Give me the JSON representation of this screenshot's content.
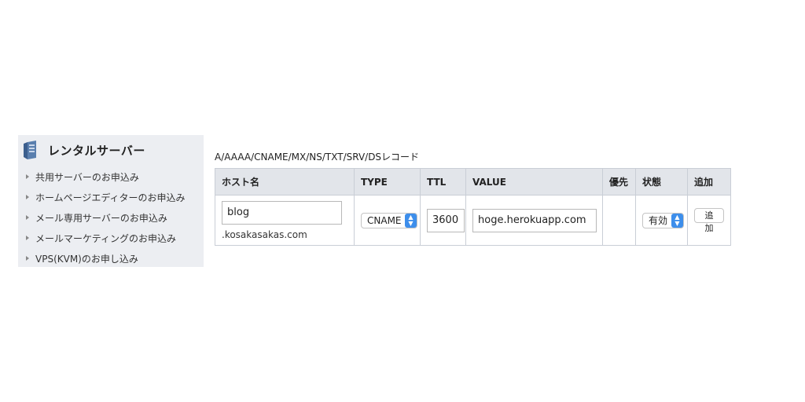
{
  "sidebar": {
    "title": "レンタルサーバー",
    "items": [
      {
        "label": "共用サーバーのお申込み"
      },
      {
        "label": "ホームページエディターのお申込み"
      },
      {
        "label": "メール専用サーバーのお申込み"
      },
      {
        "label": "メールマーケティングのお申込み"
      },
      {
        "label": "VPS(KVM)のお申し込み"
      }
    ]
  },
  "records": {
    "caption": "A/AAAA/CNAME/MX/NS/TXT/SRV/DSレコード",
    "headers": {
      "host": "ホスト名",
      "type": "TYPE",
      "ttl": "TTL",
      "value": "VALUE",
      "priority": "優先",
      "state": "状態",
      "add": "追加"
    },
    "row": {
      "host": "blog",
      "domain_suffix": ".kosakasakas.com",
      "type": "CNAME",
      "ttl": "3600",
      "value": "hoge.herokuapp.com",
      "priority": "",
      "state": "有効",
      "add_label": "追加"
    }
  },
  "colors": {
    "sidebar_bg": "#eceef2",
    "header_bg": "#e2e5ea",
    "select_accent": "#3d8eeb"
  }
}
